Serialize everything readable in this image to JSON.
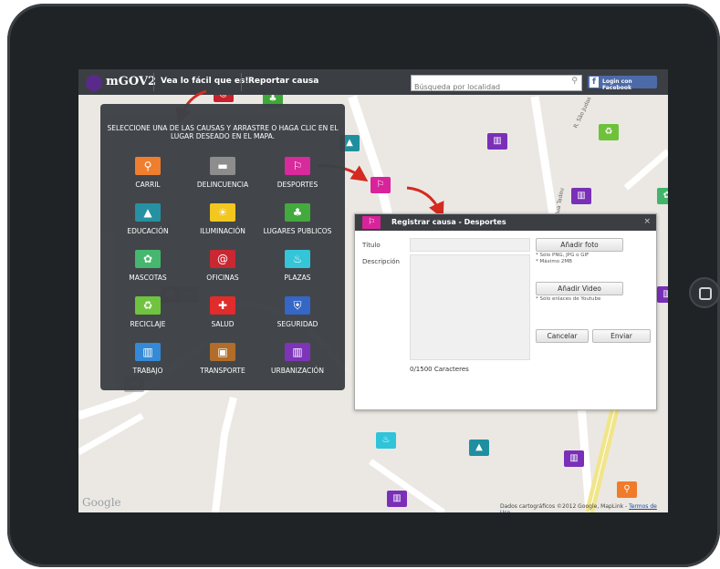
{
  "header": {
    "logo_text": "mGOV2",
    "nav_easy": "Vea lo fácil que es!",
    "nav_report": "Reportar causa",
    "search_placeholder": "Búsqueda por localidad",
    "facebook_label": "Login con Facebook",
    "facebook_icon": "f"
  },
  "panel": {
    "title": "SELECCIONE UNA DE LAS CAUSAS Y ARRASTRE O HAGA CLIC EN EL LUGAR DESEADO EN EL MAPA.",
    "causes": [
      {
        "label": "CARRIL",
        "icon": "bicycle-icon",
        "glyph": "⚲",
        "color": "#f07b2a"
      },
      {
        "label": "DELINCUENCIA",
        "icon": "gun-icon",
        "glyph": "▬",
        "color": "#8b8b8b"
      },
      {
        "label": "DESPORTES",
        "icon": "runner-icon",
        "glyph": "⚐",
        "color": "#d8239b"
      },
      {
        "label": "EDUCACIÓN",
        "icon": "graduation-cap-icon",
        "glyph": "▲",
        "color": "#1f8fa0"
      },
      {
        "label": "ILUMINACIÓN",
        "icon": "streetlight-icon",
        "glyph": "☀",
        "color": "#f3c61a"
      },
      {
        "label": "LUGARES PUBLICOS",
        "icon": "tree-icon",
        "glyph": "♣",
        "color": "#3ea838"
      },
      {
        "label": "MASCOTAS",
        "icon": "paw-icon",
        "glyph": "✿",
        "color": "#41b66b"
      },
      {
        "label": "OFICINAS",
        "icon": "paperclip-icon",
        "glyph": "@",
        "color": "#c8212c"
      },
      {
        "label": "PLAZAS",
        "icon": "fountain-icon",
        "glyph": "♨",
        "color": "#2fc4d9"
      },
      {
        "label": "RECICLAJE",
        "icon": "recycle-icon",
        "glyph": "♻",
        "color": "#6dc23a"
      },
      {
        "label": "SALUD",
        "icon": "cross-icon",
        "glyph": "✚",
        "color": "#e02626"
      },
      {
        "label": "SEGURIDAD",
        "icon": "shield-icon",
        "glyph": "⛨",
        "color": "#2f63c6"
      },
      {
        "label": "TRABAJO",
        "icon": "building-icon",
        "glyph": "▥",
        "color": "#2f87d6"
      },
      {
        "label": "TRANSPORTE",
        "icon": "bus-icon",
        "glyph": "▣",
        "color": "#b06a24"
      },
      {
        "label": "URBANIZACIÓN",
        "icon": "buildings-icon",
        "glyph": "▥",
        "color": "#7a2fb8"
      }
    ]
  },
  "dialog": {
    "title": "Registrar causa - Desportes",
    "close_icon": "×",
    "title_label": "Título",
    "description_label": "Descripción",
    "add_photo": "Añadir foto",
    "photo_note_1": "* Sólo PNG, JPG o GIF",
    "photo_note_2": "* Máximo 2MB",
    "add_video": "Añadir Video",
    "video_note": "* Sólo enlaces de Youtube",
    "cancel": "Cancelar",
    "send": "Enviar",
    "counter": "0/1500 Caracteres"
  },
  "map": {
    "google_logo": "Google",
    "attribution": "Dados cartográficos ©2012 Google, MapLink - ",
    "terms_link": "Termos de Uso",
    "street_1": "R. São Judas",
    "street_2": "Rua Tadeu"
  }
}
